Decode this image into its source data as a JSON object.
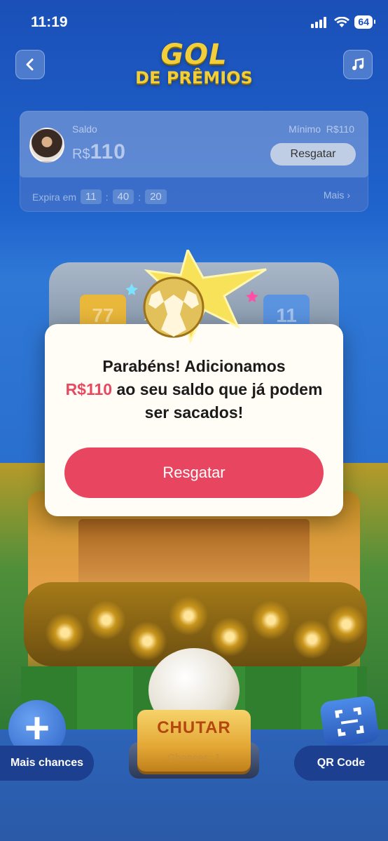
{
  "status_bar": {
    "time": "11:19",
    "battery": "64"
  },
  "header": {
    "logo_line1": "GOL",
    "logo_line2": "DE PRÊMIOS"
  },
  "balance_card": {
    "saldo_label": "Saldo",
    "currency": "R$",
    "amount": "110",
    "minimum_label": "Mínimo",
    "minimum_value": "R$110",
    "resgatar_button": "Resgatar",
    "expires_label": "Expira em",
    "timer": {
      "hours": "11",
      "minutes": "40",
      "seconds": "20"
    },
    "more_link": "Mais ›"
  },
  "game": {
    "reels": [
      "77",
      "11"
    ],
    "shoot_button": "CHUTAR",
    "chances_text": "Chances: 1",
    "more_chances_button": "Mais chances",
    "qr_button": "QR Code"
  },
  "modal": {
    "message_part1": "Parabéns! Adicionamos",
    "message_highlight": "R$110",
    "message_part2": " ao seu saldo que já podem ser sacados!",
    "primary_button": "Resgatar"
  },
  "colors": {
    "accent": "#E84660",
    "background": "#1F63CC",
    "logo": "#F2CF3A"
  }
}
